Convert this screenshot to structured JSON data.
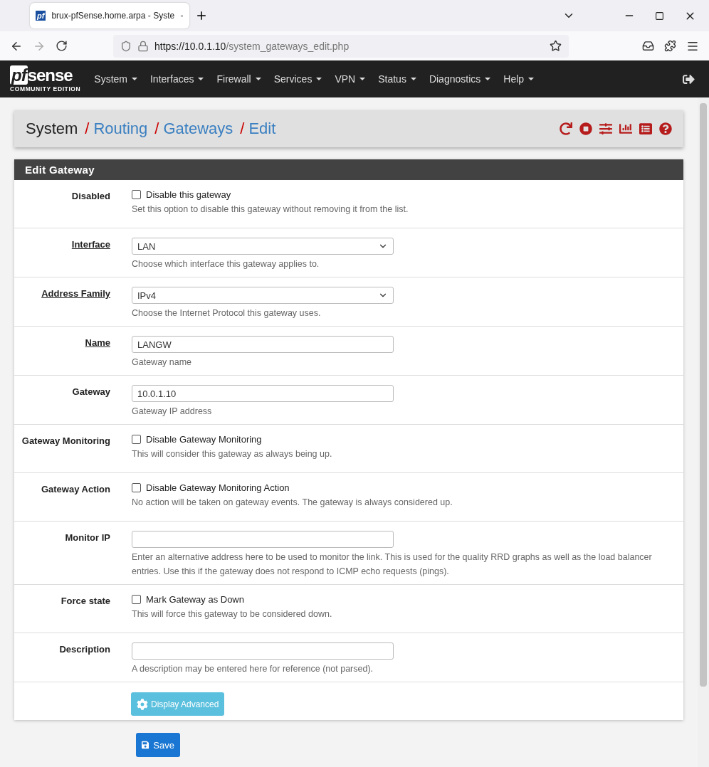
{
  "browser": {
    "favicon": "pf",
    "tab_title": "brux-pfSense.home.arpa - Syste",
    "url_host": "https://10.0.1.10",
    "url_path": "/system_gateways_edit.php"
  },
  "logo": {
    "mark": "pf",
    "word": "sense",
    "edition": "COMMUNITY EDITION"
  },
  "menu": [
    "System",
    "Interfaces",
    "Firewall",
    "Services",
    "VPN",
    "Status",
    "Diagnostics",
    "Help"
  ],
  "breadcrumb_separator": "/",
  "breadcrumb": [
    {
      "label": "System",
      "link": false
    },
    {
      "label": "Routing",
      "link": true
    },
    {
      "label": "Gateways",
      "link": true
    },
    {
      "label": "Edit",
      "link": true
    }
  ],
  "panel": {
    "title": "Edit Gateway"
  },
  "rows": [
    {
      "label": "Disabled",
      "underlined": false,
      "kind": "checkbox",
      "checked": false,
      "text": "Disable this gateway",
      "help": "Set this option to disable this gateway without removing it from the list."
    },
    {
      "label": "Interface",
      "underlined": true,
      "kind": "select",
      "value": "LAN",
      "help": "Choose which interface this gateway applies to."
    },
    {
      "label": "Address Family",
      "underlined": true,
      "kind": "select",
      "value": "IPv4",
      "help": "Choose the Internet Protocol this gateway uses."
    },
    {
      "label": "Name",
      "underlined": true,
      "kind": "input",
      "value": "LANGW",
      "help": "Gateway name"
    },
    {
      "label": "Gateway",
      "underlined": false,
      "kind": "input",
      "value": "10.0.1.10",
      "help": "Gateway IP address"
    },
    {
      "label": "Gateway Monitoring",
      "underlined": false,
      "kind": "checkbox",
      "checked": false,
      "text": "Disable Gateway Monitoring",
      "help": "This will consider this gateway as always being up."
    },
    {
      "label": "Gateway Action",
      "underlined": false,
      "kind": "checkbox",
      "checked": false,
      "text": "Disable Gateway Monitoring Action",
      "help": "No action will be taken on gateway events. The gateway is always considered up."
    },
    {
      "label": "Monitor IP",
      "underlined": false,
      "kind": "input",
      "help": "Enter an alternative address here to be used to monitor the link. This is used for the quality RRD graphs as well as the load balancer entries. Use this if the gateway does not respond to ICMP echo requests (pings)."
    },
    {
      "label": "Force state",
      "underlined": false,
      "kind": "checkbox",
      "checked": false,
      "text": "Mark Gateway as Down",
      "help": "This will force this gateway to be considered down."
    },
    {
      "label": "Description",
      "underlined": false,
      "kind": "input",
      "help": "A description may be entered here for reference (not parsed)."
    }
  ],
  "advanced_button": "Display Advanced",
  "save_button": "Save"
}
